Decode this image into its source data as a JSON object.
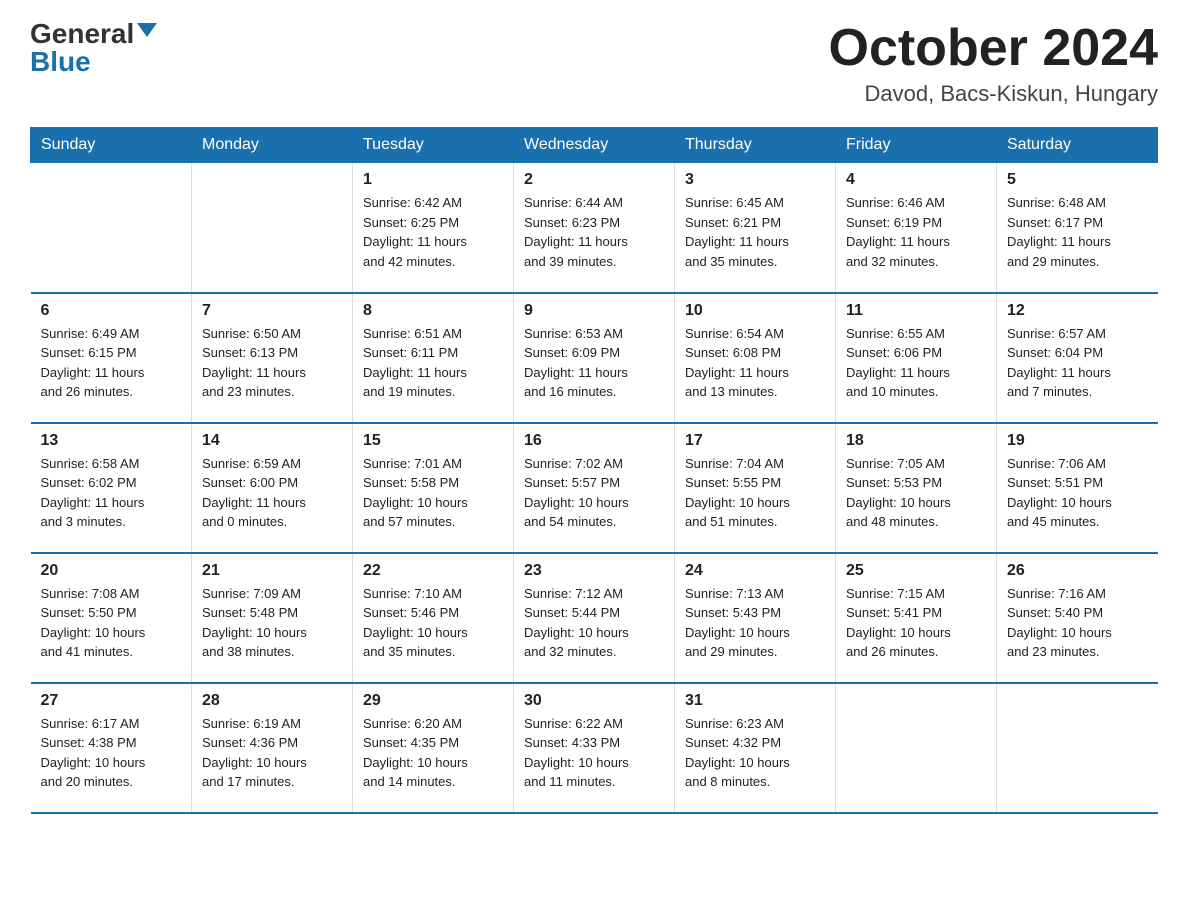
{
  "logo": {
    "general": "General",
    "blue": "Blue",
    "triangle": "▲"
  },
  "title": "October 2024",
  "location": "Davod, Bacs-Kiskun, Hungary",
  "days_of_week": [
    "Sunday",
    "Monday",
    "Tuesday",
    "Wednesday",
    "Thursday",
    "Friday",
    "Saturday"
  ],
  "weeks": [
    [
      {
        "day": "",
        "info": ""
      },
      {
        "day": "",
        "info": ""
      },
      {
        "day": "1",
        "info": "Sunrise: 6:42 AM\nSunset: 6:25 PM\nDaylight: 11 hours\nand 42 minutes."
      },
      {
        "day": "2",
        "info": "Sunrise: 6:44 AM\nSunset: 6:23 PM\nDaylight: 11 hours\nand 39 minutes."
      },
      {
        "day": "3",
        "info": "Sunrise: 6:45 AM\nSunset: 6:21 PM\nDaylight: 11 hours\nand 35 minutes."
      },
      {
        "day": "4",
        "info": "Sunrise: 6:46 AM\nSunset: 6:19 PM\nDaylight: 11 hours\nand 32 minutes."
      },
      {
        "day": "5",
        "info": "Sunrise: 6:48 AM\nSunset: 6:17 PM\nDaylight: 11 hours\nand 29 minutes."
      }
    ],
    [
      {
        "day": "6",
        "info": "Sunrise: 6:49 AM\nSunset: 6:15 PM\nDaylight: 11 hours\nand 26 minutes."
      },
      {
        "day": "7",
        "info": "Sunrise: 6:50 AM\nSunset: 6:13 PM\nDaylight: 11 hours\nand 23 minutes."
      },
      {
        "day": "8",
        "info": "Sunrise: 6:51 AM\nSunset: 6:11 PM\nDaylight: 11 hours\nand 19 minutes."
      },
      {
        "day": "9",
        "info": "Sunrise: 6:53 AM\nSunset: 6:09 PM\nDaylight: 11 hours\nand 16 minutes."
      },
      {
        "day": "10",
        "info": "Sunrise: 6:54 AM\nSunset: 6:08 PM\nDaylight: 11 hours\nand 13 minutes."
      },
      {
        "day": "11",
        "info": "Sunrise: 6:55 AM\nSunset: 6:06 PM\nDaylight: 11 hours\nand 10 minutes."
      },
      {
        "day": "12",
        "info": "Sunrise: 6:57 AM\nSunset: 6:04 PM\nDaylight: 11 hours\nand 7 minutes."
      }
    ],
    [
      {
        "day": "13",
        "info": "Sunrise: 6:58 AM\nSunset: 6:02 PM\nDaylight: 11 hours\nand 3 minutes."
      },
      {
        "day": "14",
        "info": "Sunrise: 6:59 AM\nSunset: 6:00 PM\nDaylight: 11 hours\nand 0 minutes."
      },
      {
        "day": "15",
        "info": "Sunrise: 7:01 AM\nSunset: 5:58 PM\nDaylight: 10 hours\nand 57 minutes."
      },
      {
        "day": "16",
        "info": "Sunrise: 7:02 AM\nSunset: 5:57 PM\nDaylight: 10 hours\nand 54 minutes."
      },
      {
        "day": "17",
        "info": "Sunrise: 7:04 AM\nSunset: 5:55 PM\nDaylight: 10 hours\nand 51 minutes."
      },
      {
        "day": "18",
        "info": "Sunrise: 7:05 AM\nSunset: 5:53 PM\nDaylight: 10 hours\nand 48 minutes."
      },
      {
        "day": "19",
        "info": "Sunrise: 7:06 AM\nSunset: 5:51 PM\nDaylight: 10 hours\nand 45 minutes."
      }
    ],
    [
      {
        "day": "20",
        "info": "Sunrise: 7:08 AM\nSunset: 5:50 PM\nDaylight: 10 hours\nand 41 minutes."
      },
      {
        "day": "21",
        "info": "Sunrise: 7:09 AM\nSunset: 5:48 PM\nDaylight: 10 hours\nand 38 minutes."
      },
      {
        "day": "22",
        "info": "Sunrise: 7:10 AM\nSunset: 5:46 PM\nDaylight: 10 hours\nand 35 minutes."
      },
      {
        "day": "23",
        "info": "Sunrise: 7:12 AM\nSunset: 5:44 PM\nDaylight: 10 hours\nand 32 minutes."
      },
      {
        "day": "24",
        "info": "Sunrise: 7:13 AM\nSunset: 5:43 PM\nDaylight: 10 hours\nand 29 minutes."
      },
      {
        "day": "25",
        "info": "Sunrise: 7:15 AM\nSunset: 5:41 PM\nDaylight: 10 hours\nand 26 minutes."
      },
      {
        "day": "26",
        "info": "Sunrise: 7:16 AM\nSunset: 5:40 PM\nDaylight: 10 hours\nand 23 minutes."
      }
    ],
    [
      {
        "day": "27",
        "info": "Sunrise: 6:17 AM\nSunset: 4:38 PM\nDaylight: 10 hours\nand 20 minutes."
      },
      {
        "day": "28",
        "info": "Sunrise: 6:19 AM\nSunset: 4:36 PM\nDaylight: 10 hours\nand 17 minutes."
      },
      {
        "day": "29",
        "info": "Sunrise: 6:20 AM\nSunset: 4:35 PM\nDaylight: 10 hours\nand 14 minutes."
      },
      {
        "day": "30",
        "info": "Sunrise: 6:22 AM\nSunset: 4:33 PM\nDaylight: 10 hours\nand 11 minutes."
      },
      {
        "day": "31",
        "info": "Sunrise: 6:23 AM\nSunset: 4:32 PM\nDaylight: 10 hours\nand 8 minutes."
      },
      {
        "day": "",
        "info": ""
      },
      {
        "day": "",
        "info": ""
      }
    ]
  ]
}
